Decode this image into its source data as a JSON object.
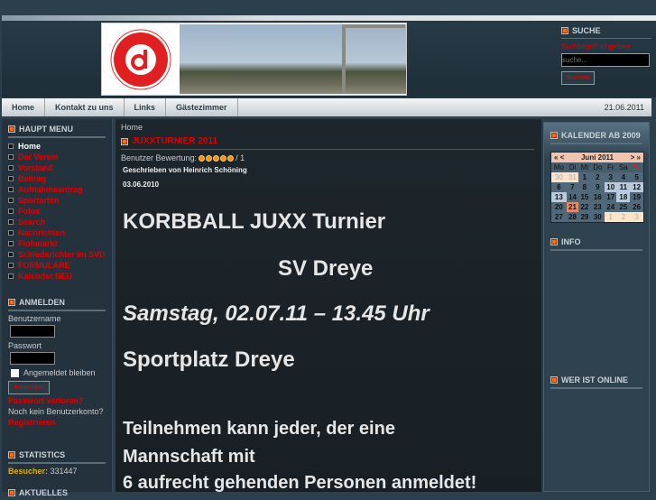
{
  "logo": {
    "ring_text": "SPORTVEREIN DREYE e.V.",
    "letter": "d",
    "since": "seit 1968"
  },
  "search": {
    "title": "SUCHE",
    "label": "Suchbegriff eingeben:",
    "placeholder": "suche...",
    "button": "Suchen"
  },
  "nav": {
    "items": [
      "Home",
      "Kontakt zu uns",
      "Links",
      "Gästezimmer"
    ],
    "date": "21.06.2011"
  },
  "main_menu": {
    "title": "HAUPT MENU",
    "items": [
      "Home",
      "Der Verein",
      "Vorstand",
      "Beitrag",
      "Aufnahmeantrag",
      "Sportarten",
      "Fotos",
      "Search",
      "Nachrichten",
      "Flohmarkt",
      "Schiedsrichter im SVD",
      "FORMULARE",
      "Kalender NEU"
    ]
  },
  "login": {
    "title": "ANMELDEN",
    "username_label": "Benutzername",
    "password_label": "Passwort",
    "remember": "Angemeldet bleiben",
    "button": "Anmelden",
    "lost": "Passwort verloren?",
    "no_account": "Noch kein Benutzerkonto?",
    "register": "Registrieren"
  },
  "stats": {
    "title": "STATISTICS",
    "label": "Besucher:",
    "value": "331447"
  },
  "aktuelles": {
    "title": "AKTUELLES"
  },
  "article": {
    "breadcrumb": "Home",
    "title": "JUXXTURNIER 2011",
    "rating_label": "Benutzer Bewertung:",
    "rating_count": "/ 1",
    "rating": 5,
    "author": "Geschrieben von Heinrich Schöning",
    "date": "03.06.2010",
    "lines": [
      "KORBBALL JUXX Turnier",
      "SV Dreye",
      "Samstag, 02.07.11  – 13.45 Uhr",
      "Sportplatz Dreye",
      "Teilnehmen kann jeder, der eine",
      "Mannschaft mit",
      "6 aufrecht gehenden Personen anmeldet!"
    ]
  },
  "calendar": {
    "title": "KALENDER AB 2009",
    "prev_year": "«",
    "prev": "<",
    "month": "Juni 2011",
    "next": ">",
    "next_year": "»",
    "weekdays": [
      "Mo",
      "Di",
      "Mi",
      "Do",
      "Fr",
      "Sa",
      "So"
    ],
    "weeks": [
      [
        "30",
        "31",
        "1",
        "2",
        "3",
        "4",
        "5"
      ],
      [
        "6",
        "7",
        "8",
        "9",
        "10",
        "11",
        "12"
      ],
      [
        "13",
        "14",
        "15",
        "16",
        "17",
        "18",
        "19"
      ],
      [
        "20",
        "21",
        "22",
        "23",
        "24",
        "25",
        "26"
      ],
      [
        "27",
        "28",
        "29",
        "30",
        "1",
        "2",
        "3"
      ]
    ],
    "today": "21",
    "highlighted": [
      "10",
      "11",
      "12",
      "13",
      "18"
    ]
  },
  "info": {
    "title": "INFO"
  },
  "online": {
    "title": "WER IST ONLINE"
  }
}
